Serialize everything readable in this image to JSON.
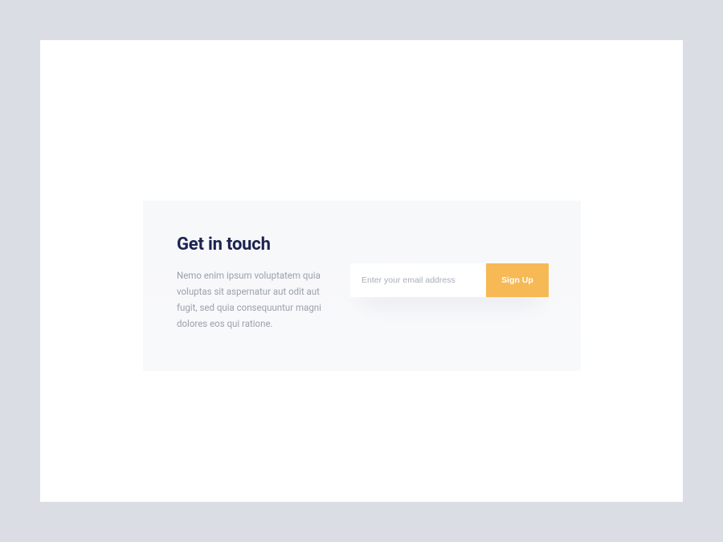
{
  "colors": {
    "page_bg": "#dadde3",
    "canvas_bg": "#ffffff",
    "card_bg": "#f7f8fa",
    "headline": "#1c2350",
    "body": "#9aa0ae",
    "button": "#f7b955",
    "button_text": "#ffffff"
  },
  "contact": {
    "headline": "Get in touch",
    "body": "Nemo enim ipsum voluptatem quia voluptas sit aspernatur aut odit aut fugit, sed quia consequuntur magni dolores eos qui ratione.",
    "email_placeholder": "Enter your email address",
    "email_value": "",
    "submit_label": "Sign Up"
  }
}
